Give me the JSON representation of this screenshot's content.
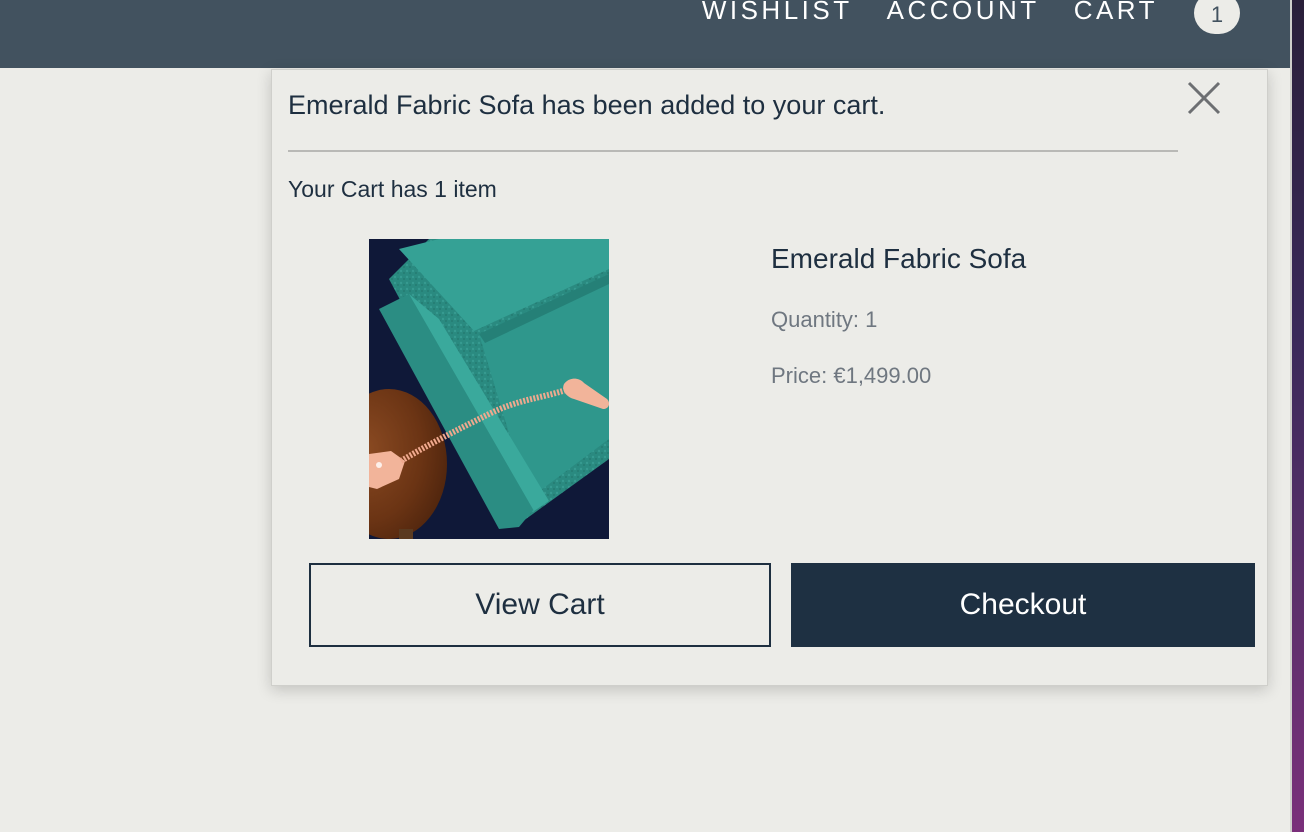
{
  "header": {
    "nav": {
      "wishlist": "WISHLIST",
      "account": "ACCOUNT",
      "cart": "CART"
    },
    "cart_count": "1",
    "background_color": "#42525f"
  },
  "popup": {
    "title": "Emerald Fabric Sofa has been added to your cart.",
    "cart_summary": "Your Cart has 1 item",
    "close_icon": "close-icon",
    "product": {
      "name": "Emerald Fabric Sofa",
      "quantity": "Quantity: 1",
      "price": "Price: €1,499.00",
      "image_icon": "sofa-product-image"
    },
    "buttons": {
      "view_cart": "View Cart",
      "checkout": "Checkout"
    },
    "colors": {
      "primary": "#1e3042",
      "muted_text": "#6f7780",
      "background": "#ecece8"
    }
  }
}
